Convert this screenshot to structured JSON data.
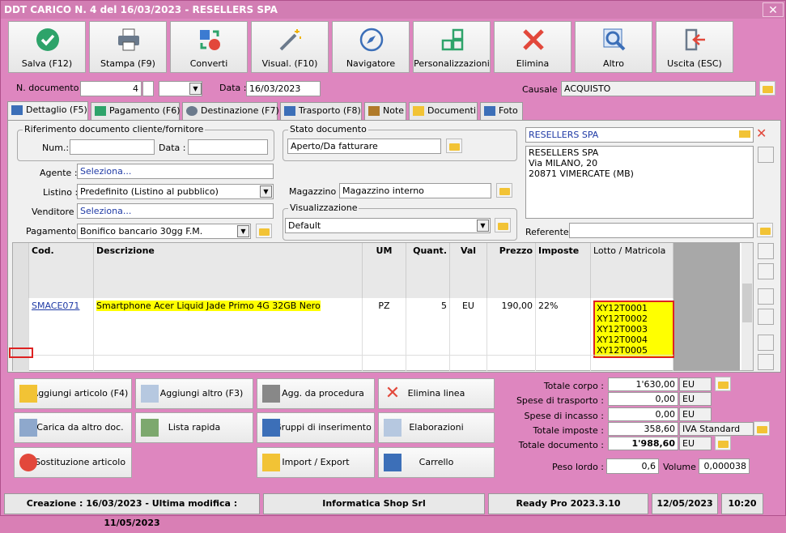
{
  "window": {
    "title": "DDT CARICO N. 4 del 16/03/2023 - RESELLERS SPA",
    "close": "✕"
  },
  "toolbar": [
    {
      "label": "Salva (F12)",
      "icon": "check-icon"
    },
    {
      "label": "Stampa (F9)",
      "icon": "printer-icon"
    },
    {
      "label": "Converti",
      "icon": "convert-icon"
    },
    {
      "label": "Visual. (F10)",
      "icon": "wand-icon"
    },
    {
      "label": "Navigatore",
      "icon": "compass-icon"
    },
    {
      "label": "Personalizzazioni",
      "icon": "grid-icon"
    },
    {
      "label": "Elimina",
      "icon": "x-icon"
    },
    {
      "label": "Altro",
      "icon": "magnifier-icon"
    },
    {
      "label": "Uscita (ESC)",
      "icon": "exit-icon"
    }
  ],
  "header": {
    "ndoc_label": "N. documento :",
    "ndoc": "4",
    "data_label": "Data :",
    "data": "16/03/2023",
    "causale_label": "Causale :",
    "causale": "ACQUISTO"
  },
  "tabs": [
    "Dettaglio (F5)",
    "Pagamento (F6)",
    "Destinazione (F7)",
    "Trasporto (F8)",
    "Note",
    "Documenti",
    "Foto"
  ],
  "rif": {
    "title": "Riferimento documento cliente/fornitore",
    "num_label": "Num.:",
    "num": "",
    "data_label": "Data :",
    "data": ""
  },
  "stato": {
    "title": "Stato documento",
    "value": "Aperto/Da fatturare"
  },
  "cliente": {
    "name": "RESELLERS SPA",
    "address": [
      "RESELLERS SPA",
      "Via MILANO, 20",
      "20871 VIMERCATE (MB)"
    ],
    "referente_label": "Referente",
    "referente": ""
  },
  "fields": {
    "agente_label": "Agente :",
    "agente": "Seleziona...",
    "listino_label": "Listino :",
    "listino": "Predefinito (Listino al pubblico)",
    "venditore_label": "Venditore :",
    "venditore": "Seleziona...",
    "pagamento_label": "Pagamento :",
    "pagamento": "Bonifico bancario 30gg F.M.",
    "magazzino_label": "Magazzino :",
    "magazzino": "Magazzino interno",
    "visual_title": "Visualizzazione",
    "visual": "Default"
  },
  "grid": {
    "headers": [
      "Cod.",
      "Descrizione",
      "UM",
      "Quant.",
      "Val",
      "Prezzo",
      "Imposte",
      "Lotto / Matricola"
    ],
    "row": {
      "cod": "SMACE071",
      "desc": "Smartphone Acer Liquid Jade Primo 4G 32GB Nero",
      "um": "PZ",
      "quant": "5",
      "val": "EU",
      "prezzo": "190,00",
      "imposte": "22%",
      "lotti": [
        "XY12T0001",
        "XY12T0002",
        "XY12T0003",
        "XY12T0004",
        "XY12T0005"
      ]
    }
  },
  "buttons": [
    "Aggiungi articolo (F4)",
    "Aggiungi altro (F3)",
    "Agg. da procedura",
    "Elimina linea",
    "Carica da altro doc.",
    "Lista rapida",
    "Gruppi di inserimento",
    "Elaborazioni",
    "Sostituzione articolo",
    "Import / Export",
    "Carrello"
  ],
  "totali": {
    "corpo_label": "Totale corpo :",
    "corpo": "1'630,00",
    "corpo_val": "EU",
    "trasporto_label": "Spese di trasporto :",
    "trasporto": "0,00",
    "trasporto_val": "EU",
    "incasso_label": "Spese di incasso :",
    "incasso": "0,00",
    "incasso_val": "EU",
    "imposte_label": "Totale imposte :",
    "imposte": "358,60",
    "imposte_val": "IVA Standard",
    "documento_label": "Totale documento :",
    "documento": "1'988,60",
    "documento_val": "EU",
    "peso_label": "Peso lordo :",
    "peso": "0,6",
    "volume_label": "Volume :",
    "volume": "0,000038"
  },
  "status": {
    "dates": "Creazione : 16/03/2023 - Ultima modifica : 11/05/2023",
    "company": "Informatica Shop Srl",
    "version": "Ready Pro 2023.3.10",
    "date": "12/05/2023",
    "time": "10:20"
  }
}
